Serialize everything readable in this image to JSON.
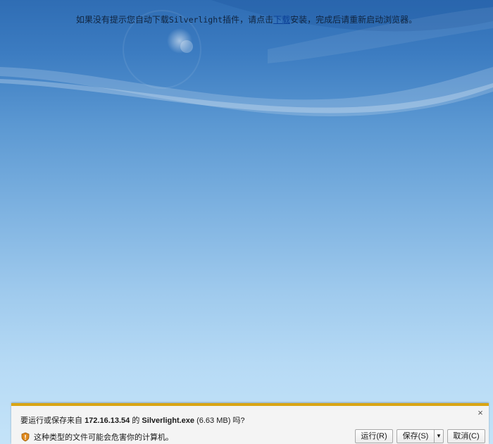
{
  "notice": {
    "before": "如果没有提示您自动下载",
    "plugin": "Silverlight",
    "middle": "插件，请点击",
    "link": "下载",
    "after": "安装，完成后请重新启动浏览器。"
  },
  "download_bar": {
    "prompt_prefix": "要运行或保存来自",
    "host": "172.16.13.54",
    "prompt_of": "的",
    "filename": "Silverlight.exe",
    "size": "(6.63 MB)",
    "prompt_suffix": "吗?",
    "warning": "这种类型的文件可能会危害你的计算机。",
    "warning_icon": "shield-warning-icon",
    "close_label": "×",
    "run_label": "运行(R)",
    "save_label": "保存(S)",
    "save_menu_label": "▼",
    "cancel_label": "取消(C)",
    "accent_color": "#d9a514"
  }
}
